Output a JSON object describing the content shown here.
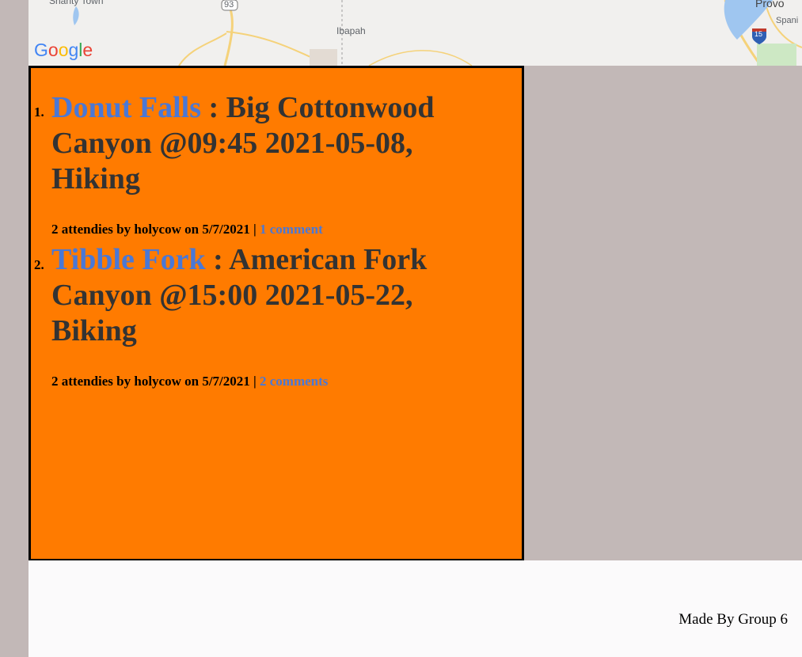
{
  "map": {
    "labels": {
      "shanty_town": "Shanty Town",
      "ibapah": "Ibapah",
      "provo": "Provo",
      "spanish": "Spani",
      "route_93": "93",
      "route_15": "15"
    },
    "logo": {
      "g1": "G",
      "o1": "o",
      "o2": "o",
      "g2": "g",
      "l": "l",
      "e": "e"
    }
  },
  "events": [
    {
      "number": "1.",
      "link": "Donut Falls",
      "details": " : Big Cottonwood Canyon @09:45 2021-05-08, Hiking",
      "meta_prefix": "2 attendies by holycow on 5/7/2021 | ",
      "comments": "1 comment"
    },
    {
      "number": "2.",
      "link": "Tibble Fork",
      "details": " : American Fork Canyon @15:00 2021-05-22, Biking",
      "meta_prefix": "2 attendies by holycow on 5/7/2021 | ",
      "comments": "2 comments"
    }
  ],
  "footer": {
    "text": "Made By Group 6"
  },
  "colors": {
    "page_bg": "#c2b8b7",
    "box_bg": "#ff7b00",
    "link": "#4a78d6",
    "title_text": "#333333",
    "footer_bg": "#fbfafb"
  }
}
